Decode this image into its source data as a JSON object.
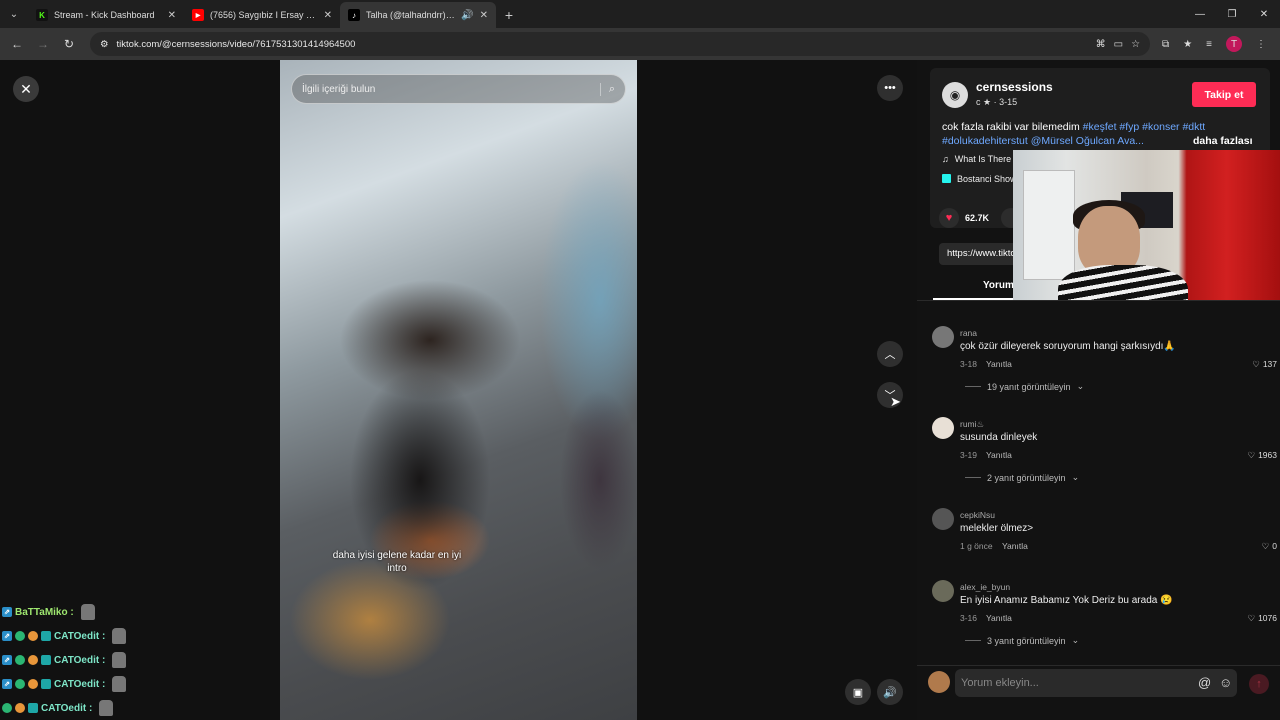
{
  "tabs": [
    {
      "title": "Stream - Kick Dashboard",
      "favicon": "K",
      "favicon_type": "kick"
    },
    {
      "title": "(7656) Saygıbiz I Ersay Üner, Gi",
      "favicon": "▶",
      "favicon_type": "youtube"
    },
    {
      "title": "Talha (@talhadndrr) | TikTok",
      "favicon": "♪",
      "favicon_type": "tiktok",
      "active": true
    }
  ],
  "address": {
    "url": "tiktok.com/@cernsessions/video/7617531301414964500"
  },
  "video": {
    "search_placeholder": "İlgili içeriği bulun",
    "caption": "daha iyisi gelene kadar en iyi intro"
  },
  "creator": {
    "avatar": "◉",
    "username": "cernsessions",
    "meta": "c ★ · 3-15",
    "follow_label": "Takip et",
    "desc_text": "cok fazla rakibi var bilemedim ",
    "desc_tags": "#keşfet #fyp #konser #dktt #dolukadehiterstut @Mürsel Oğulcan Ava...",
    "more_label": "daha fazlası",
    "music": "What Is There",
    "place": "Bostanci Show",
    "likes": "62.7K",
    "link": "https://www.tiktok.com",
    "comments_tab": "Yorumlar"
  },
  "comments": [
    {
      "user": "rana",
      "text": "çok özür dileyerek soruyorum hangi şarkısıydı🙏",
      "date": "3-18",
      "reply": "Yanıtla",
      "likes": "137",
      "replies": "19 yanıt görüntüleyin"
    },
    {
      "user": "rumi♨",
      "text": "susunda dinleyek",
      "date": "3-19",
      "reply": "Yanıtla",
      "likes": "1963",
      "replies": "2 yanıt görüntüleyin"
    },
    {
      "user": "cepkiNsu",
      "text": "melekler ölmez>",
      "date": "1 g önce",
      "reply": "Yanıtla",
      "likes": "0",
      "replies": ""
    },
    {
      "user": "alex_ie_byun",
      "text": "En iyisi Anamız Babamız Yok Deriz bu arada 😢",
      "date": "3-16",
      "reply": "Yanıtla",
      "likes": "1076",
      "replies": "3 yanıt görüntüleyin"
    }
  ],
  "comment_input": {
    "placeholder": "Yorum ekleyin..."
  },
  "chat": [
    {
      "user": "BaTTaMiko :",
      "style": "a"
    },
    {
      "user": "CATOedit :",
      "style": "b"
    },
    {
      "user": "CATOedit :",
      "style": "b"
    },
    {
      "user": "CATOedit :",
      "style": "b"
    },
    {
      "user": "CATOedit :",
      "style": "b"
    }
  ],
  "colors": {
    "accent": "#fe2c55",
    "tag": "#6ea8ff",
    "kick": "#53fc18"
  }
}
